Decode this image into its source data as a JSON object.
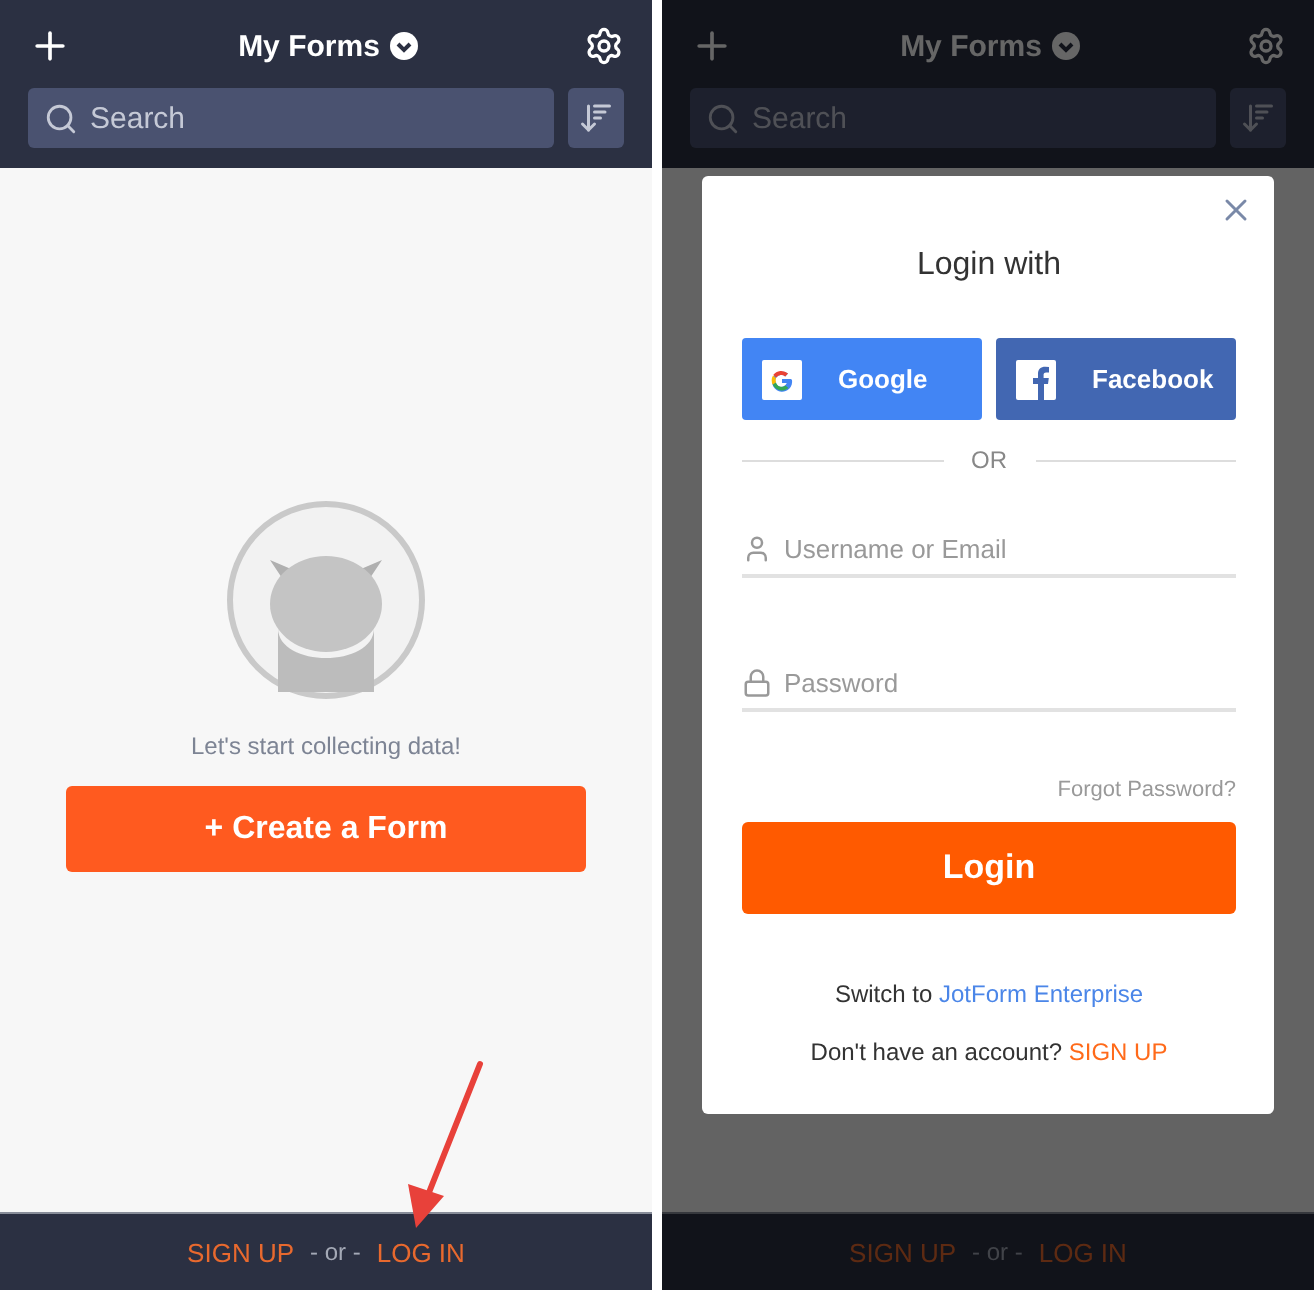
{
  "screens": [
    {
      "header": {
        "title": "My Forms",
        "search": {
          "placeholder": "Search"
        }
      },
      "empty_state": {
        "message": "Let's start collecting data!",
        "button": "+ Create a Form"
      },
      "footer": {
        "sign_up": "SIGN UP",
        "separator": "- or -",
        "log_in": "LOG IN"
      },
      "annotation": {
        "kind": "arrow"
      },
      "dimmed": false
    },
    {
      "header": {
        "title": "My Forms",
        "search": {
          "placeholder": "Search"
        }
      },
      "footer": {
        "sign_up": "SIGN UP",
        "separator": "- or -",
        "log_in": "LOG IN"
      },
      "dimmed": true,
      "dialog": {
        "title": "Login with",
        "social_buttons": [
          {
            "kind": "google",
            "label": "Google"
          },
          {
            "kind": "facebook",
            "label": "Facebook"
          }
        ],
        "divider": "OR",
        "fields": [
          {
            "kind": "user",
            "placeholder": "Username or Email"
          },
          {
            "kind": "password",
            "placeholder": "Password"
          }
        ],
        "forgot_link": "Forgot Password?",
        "submit": "Login",
        "switch_prompt": {
          "text": "Switch to",
          "link": "JotForm Enterprise"
        },
        "signup_prompt": {
          "text": "Don't have an account?",
          "link": "SIGN UP"
        }
      }
    }
  ]
}
